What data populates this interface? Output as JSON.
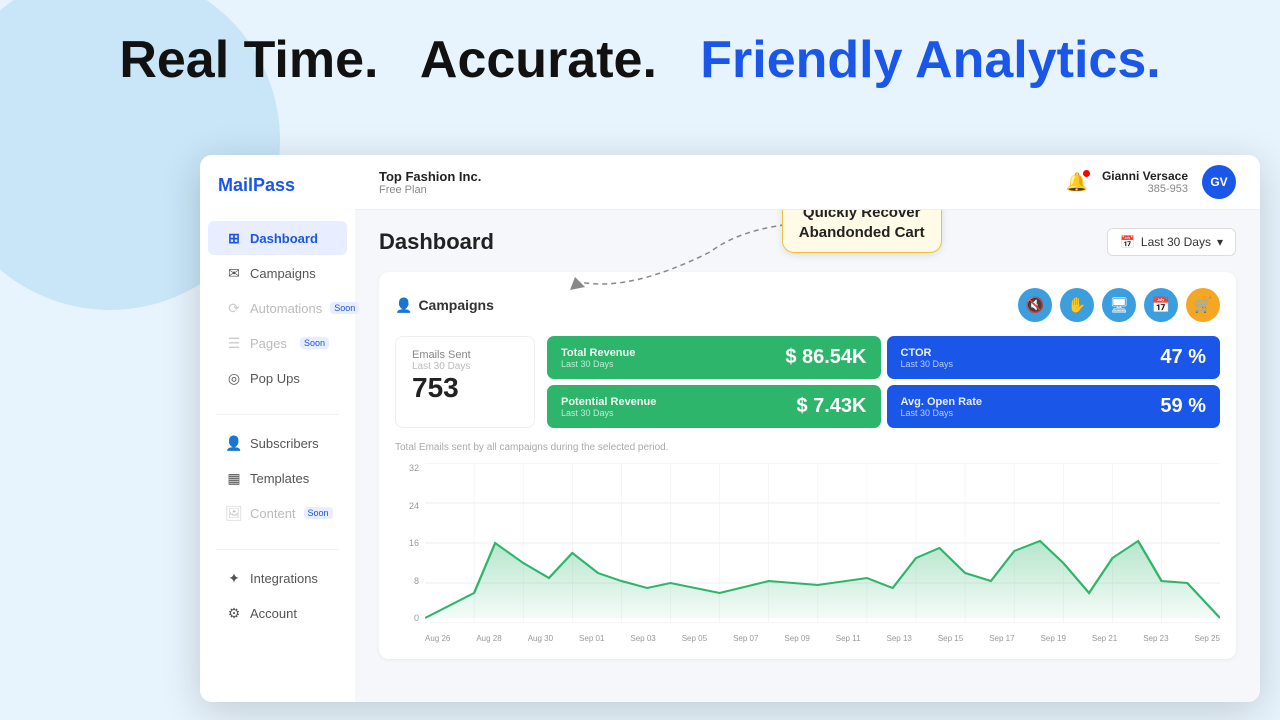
{
  "tagline": {
    "part1": "Real Time.",
    "part2": "Accurate.",
    "part3": "Friendly Analytics."
  },
  "header": {
    "company_name": "Top Fashion Inc.",
    "plan": "Free Plan",
    "bell_icon": "bell",
    "user_name": "Gianni Versace",
    "user_id": "385-953",
    "avatar_initials": "GV"
  },
  "sidebar": {
    "logo_part1": "Mail",
    "logo_part2": "Pass",
    "items": [
      {
        "id": "dashboard",
        "label": "Dashboard",
        "icon": "⊞",
        "active": true,
        "soon": false
      },
      {
        "id": "campaigns",
        "label": "Campaigns",
        "icon": "✉",
        "active": false,
        "soon": false
      },
      {
        "id": "automations",
        "label": "Automations",
        "icon": "⟳",
        "active": false,
        "soon": true
      },
      {
        "id": "pages",
        "label": "Pages",
        "icon": "☰",
        "active": false,
        "soon": true
      },
      {
        "id": "popups",
        "label": "Pop Ups",
        "icon": "◎",
        "active": false,
        "soon": false
      },
      {
        "id": "subscribers",
        "label": "Subscribers",
        "icon": "👤",
        "active": false,
        "soon": false
      },
      {
        "id": "templates",
        "label": "Templates",
        "icon": "▦",
        "active": false,
        "soon": false
      },
      {
        "id": "content",
        "label": "Content",
        "icon": "🖼",
        "active": false,
        "soon": true
      },
      {
        "id": "integrations",
        "label": "Integrations",
        "icon": "✦",
        "active": false,
        "soon": false
      },
      {
        "id": "account",
        "label": "Account",
        "icon": "⚙",
        "active": false,
        "soon": false
      }
    ]
  },
  "page": {
    "title": "Dashboard",
    "date_range": "Last 30 Days"
  },
  "campaigns_panel": {
    "title": "Campaigns",
    "callout_line1": "Quickly Recover",
    "callout_line2": "Abandonded Cart"
  },
  "metrics": {
    "emails_sent_label": "Emails Sent",
    "emails_sent_sub": "Last 30 Days",
    "emails_sent_count": "753",
    "total_revenue_label": "Total Revenue",
    "total_revenue_sub": "Last 30 Days",
    "total_revenue_value": "$ 86.54K",
    "ctor_label": "CTOR",
    "ctor_sub": "Last 30 Days",
    "ctor_value": "47 %",
    "potential_revenue_label": "Potential Revenue",
    "potential_revenue_sub": "Last 30 Days",
    "potential_revenue_value": "$ 7.43K",
    "avg_open_rate_label": "Avg. Open Rate",
    "avg_open_rate_sub": "Last 30 Days",
    "avg_open_rate_value": "59 %",
    "note": "Total Emails sent by all campaigns during the selected period."
  },
  "chart": {
    "y_labels": [
      "0",
      "8",
      "16",
      "24",
      "32"
    ],
    "x_labels": [
      "Aug 26",
      "Aug 28",
      "Aug 30",
      "Sep 01",
      "Sep 03",
      "Sep 05",
      "Sep 07",
      "Sep 09",
      "Sep 11",
      "Sep 13",
      "Sep 15",
      "Sep 17",
      "Sep 19",
      "Sep 21",
      "Sep 23",
      "Sep 25"
    ]
  },
  "action_buttons": [
    {
      "id": "btn1",
      "color": "#3b9ede",
      "icon": "🔇"
    },
    {
      "id": "btn2",
      "color": "#3b9ede",
      "icon": "✋"
    },
    {
      "id": "btn3",
      "color": "#3b9ede",
      "icon": "🖥"
    },
    {
      "id": "btn4",
      "color": "#3b9ede",
      "icon": "📅"
    },
    {
      "id": "btn5",
      "color": "#f5a623",
      "icon": "🛒"
    }
  ]
}
